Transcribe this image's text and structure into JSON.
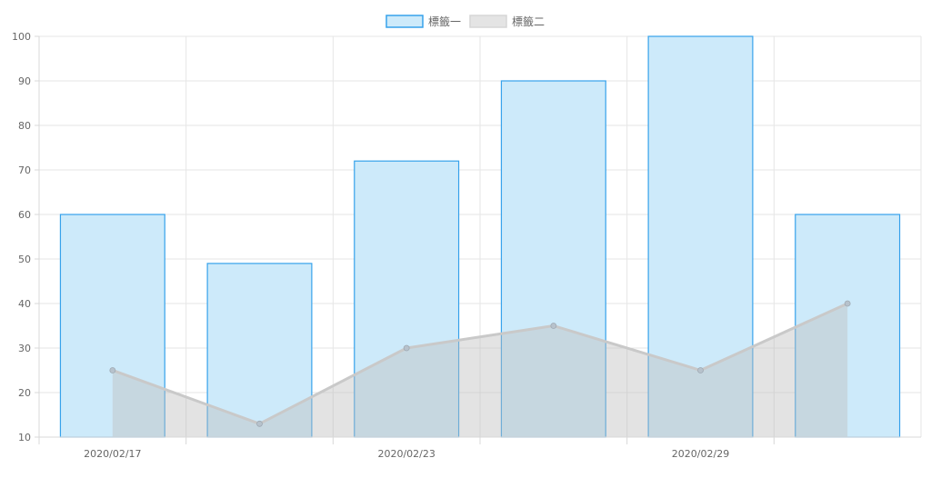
{
  "chart_data": {
    "type": "bar",
    "categories": [
      "2020/02/17",
      "",
      "2020/02/23",
      "",
      "2020/02/29",
      ""
    ],
    "x_tick_labels": [
      "2020/02/17",
      "2020/02/23",
      "2020/02/29"
    ],
    "series": [
      {
        "name": "標籤一",
        "type": "bar",
        "values": [
          60,
          49,
          72,
          90,
          100,
          60
        ],
        "fill": "#cdeafa",
        "stroke": "#36a2eb"
      },
      {
        "name": "標籤二",
        "type": "area",
        "values": [
          25,
          13,
          30,
          35,
          25,
          40
        ],
        "fill": "#bdbdbd",
        "stroke": "#c9c9c9",
        "point_fill": "#b7c2cc"
      }
    ],
    "ylim": [
      10,
      100
    ],
    "y_ticks": [
      10,
      20,
      30,
      40,
      50,
      60,
      70,
      80,
      90,
      100
    ],
    "grid": true,
    "legend_position": "top-center"
  }
}
